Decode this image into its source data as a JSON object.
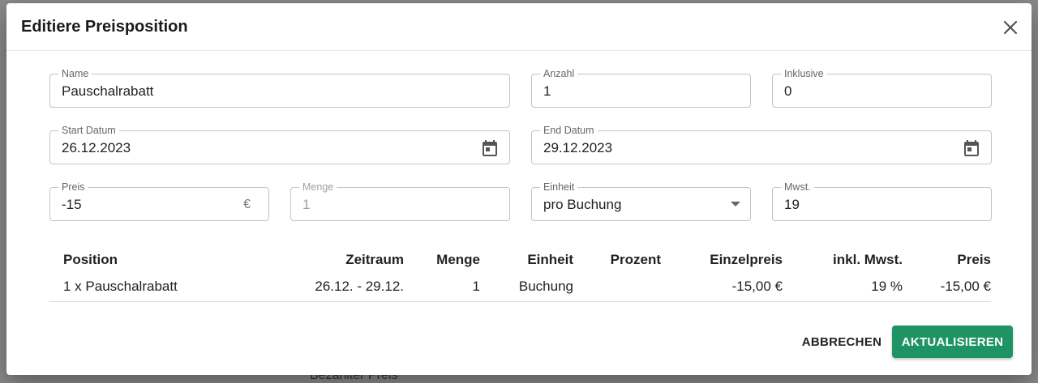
{
  "dialog": {
    "title": "Editiere Preisposition",
    "close_icon": "close-icon"
  },
  "form": {
    "name": {
      "label": "Name",
      "value": "Pauschalrabatt"
    },
    "anzahl": {
      "label": "Anzahl",
      "value": "1"
    },
    "inklusive": {
      "label": "Inklusive",
      "value": "0"
    },
    "start_datum": {
      "label": "Start Datum",
      "value": "26.12.2023",
      "icon": "calendar-icon"
    },
    "end_datum": {
      "label": "End Datum",
      "value": "29.12.2023",
      "icon": "calendar-icon"
    },
    "preis": {
      "label": "Preis",
      "value": "-15",
      "suffix": "€"
    },
    "menge": {
      "label": "Menge",
      "value": "1",
      "disabled": true
    },
    "einheit": {
      "label": "Einheit",
      "value": "pro Buchung"
    },
    "mwst": {
      "label": "Mwst.",
      "value": "19"
    }
  },
  "table": {
    "headers": [
      "Position",
      "Zeitraum",
      "Menge",
      "Einheit",
      "Prozent",
      "Einzelpreis",
      "inkl. Mwst.",
      "Preis"
    ],
    "rows": [
      [
        "1 x Pauschalrabatt",
        "26.12. - 29.12.",
        "1",
        "Buchung",
        "",
        "-15,00 €",
        "19 %",
        "-15,00 €"
      ]
    ]
  },
  "buttons": {
    "cancel": "ABBRECHEN",
    "update": "AKTUALISIEREN"
  },
  "backdrop": {
    "partial_text": "Bezahlter Preis"
  },
  "colors": {
    "accent": "#1e9464"
  }
}
